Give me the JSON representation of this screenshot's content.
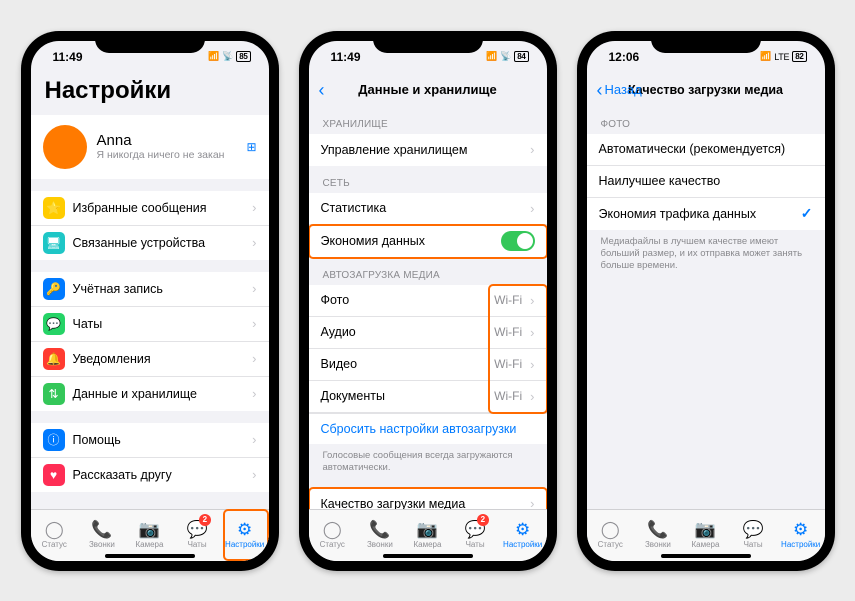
{
  "phone1": {
    "time": "11:49",
    "battery": "85",
    "title": "Настройки",
    "profile": {
      "name": "Anna",
      "sub": "Я никогда ничего не закан"
    },
    "g1": [
      {
        "icon": "⭐",
        "bg": "#ffcc00",
        "label": "Избранные сообщения"
      },
      {
        "icon": "🖥",
        "bg": "#1ec6c6",
        "label": "Связанные устройства"
      }
    ],
    "g2": [
      {
        "icon": "🔑",
        "bg": "#007aff",
        "label": "Учётная запись"
      },
      {
        "icon": "💬",
        "bg": "#25d366",
        "label": "Чаты"
      },
      {
        "icon": "🔔",
        "bg": "#ff3b30",
        "label": "Уведомления"
      },
      {
        "icon": "⇅",
        "bg": "#34c759",
        "label": "Данные и хранилище"
      }
    ],
    "g3": [
      {
        "icon": "ⓘ",
        "bg": "#007aff",
        "label": "Помощь"
      },
      {
        "icon": "♥",
        "bg": "#ff2d55",
        "label": "Рассказать другу"
      }
    ]
  },
  "phone2": {
    "time": "11:49",
    "battery": "84",
    "title": "Данные и хранилище",
    "sec_storage": "ХРАНИЛИЩЕ",
    "storage_row": "Управление хранилищем",
    "sec_net": "СЕТЬ",
    "net_stats": "Статистика",
    "net_saver": "Экономия данных",
    "sec_media": "АВТОЗАГРУЗКА МЕДИА",
    "media": [
      {
        "label": "Фото",
        "val": "Wi-Fi"
      },
      {
        "label": "Аудио",
        "val": "Wi-Fi"
      },
      {
        "label": "Видео",
        "val": "Wi-Fi"
      },
      {
        "label": "Документы",
        "val": "Wi-Fi"
      }
    ],
    "reset": "Сбросить настройки автозагрузки",
    "note": "Голосовые сообщения всегда загружаются автоматически.",
    "quality": "Качество загрузки медиа"
  },
  "phone3": {
    "time": "12:06",
    "net": "LTE",
    "battery": "82",
    "back": "Назад",
    "title": "Качество загрузки медиа",
    "sec_photo": "ФОТО",
    "options": [
      {
        "label": "Автоматически (рекомендуется)",
        "checked": false
      },
      {
        "label": "Наилучшее качество",
        "checked": false
      },
      {
        "label": "Экономия трафика данных",
        "checked": true
      }
    ],
    "note": "Медиафайлы в лучшем качестве имеют больший размер, и их отправка может занять больше времени."
  },
  "tabs": {
    "t0": {
      "icon": "◯",
      "label": "Статус"
    },
    "t1": {
      "icon": "📞",
      "label": "Звонки"
    },
    "t2": {
      "icon": "📷",
      "label": "Камера"
    },
    "t3": {
      "icon": "💬",
      "label": "Чаты",
      "badge": "2"
    },
    "t4": {
      "icon": "⚙",
      "label": "Настройки"
    }
  }
}
